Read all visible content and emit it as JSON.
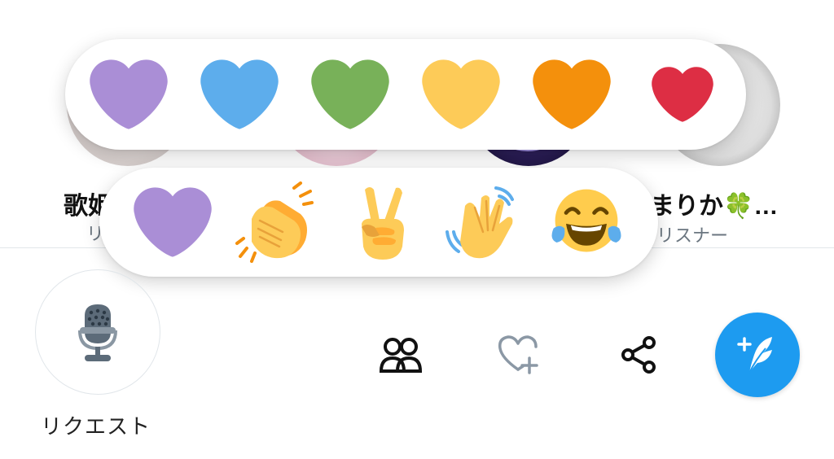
{
  "speakers": [
    {
      "name": "歌姫",
      "role": "リ"
    },
    {
      "name": "まりか🍀…",
      "role": "リスナー"
    }
  ],
  "reactions_hearts": [
    {
      "icon": "purple-heart-icon",
      "color": "#aa8ed6"
    },
    {
      "icon": "blue-heart-icon",
      "color": "#5dadec"
    },
    {
      "icon": "green-heart-icon",
      "color": "#78b159"
    },
    {
      "icon": "yellow-heart-icon",
      "color": "#fdcb58"
    },
    {
      "icon": "orange-heart-icon",
      "color": "#f4900c"
    },
    {
      "icon": "red-heart-icon",
      "color": "#dd2e44"
    }
  ],
  "reactions_emoji": [
    {
      "icon": "purple-heart-icon",
      "color": "#aa8ed6"
    },
    {
      "icon": "clapping-hands-icon",
      "color": "#fdcb58"
    },
    {
      "icon": "victory-hand-icon",
      "color": "#fdcb58"
    },
    {
      "icon": "waving-hand-icon",
      "color": "#fdcb58"
    },
    {
      "icon": "tears-of-joy-icon",
      "color": "#ffcc4d"
    }
  ],
  "controls": {
    "request_label": "リクエスト",
    "accent_color": "#1d9bf0"
  }
}
